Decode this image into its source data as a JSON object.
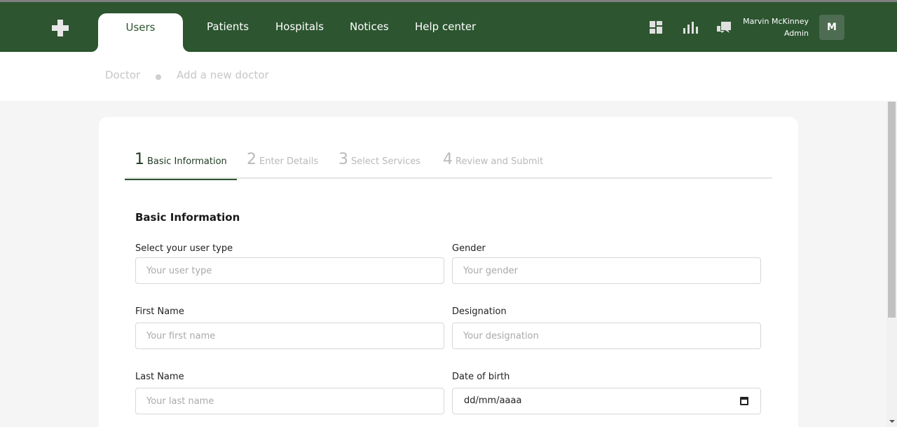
{
  "nav": {
    "tabs": [
      {
        "label": "Users",
        "active": true
      },
      {
        "label": "Patients"
      },
      {
        "label": "Hospitals"
      },
      {
        "label": "Notices"
      },
      {
        "label": "Help center"
      }
    ]
  },
  "header_icons": [
    "grid-icon",
    "bar-chart-icon",
    "chat-icon"
  ],
  "user": {
    "name": "Marvin McKinney",
    "role": "Admin",
    "initial": "M"
  },
  "breadcrumb": {
    "parent": "Doctor",
    "current": "Add a new doctor"
  },
  "steps": [
    {
      "num": "1",
      "label": "Basic Information",
      "active": true
    },
    {
      "num": "2",
      "label": "Enter Details"
    },
    {
      "num": "3",
      "label": "Select Services"
    },
    {
      "num": "4",
      "label": "Review and Submit"
    }
  ],
  "form": {
    "section_title": "Basic Information",
    "user_type": {
      "label": "Select your user type",
      "placeholder": "Your user type"
    },
    "gender": {
      "label": "Gender",
      "placeholder": "Your gender"
    },
    "first_name": {
      "label": "First Name",
      "placeholder": "Your first name"
    },
    "designation": {
      "label": "Designation",
      "placeholder": "Your designation"
    },
    "last_name": {
      "label": "Last Name",
      "placeholder": "Your last name"
    },
    "dob": {
      "label": "Date of birth",
      "value": "dd/mm/aaaa"
    }
  },
  "colors": {
    "brand": "#2c5530",
    "background": "#f5f5f5"
  }
}
